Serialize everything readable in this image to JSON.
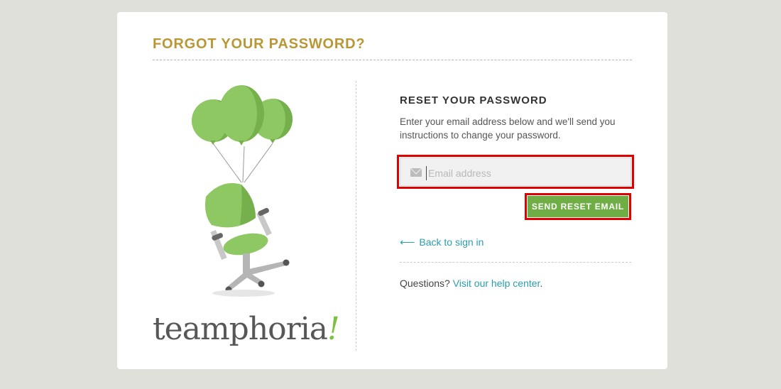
{
  "page": {
    "title": "FORGOT YOUR PASSWORD?",
    "brand_colors": {
      "title": "#b89736",
      "accent": "#6fad45",
      "link": "#2a9dae"
    }
  },
  "brand": {
    "logo_text": "teamphoria",
    "logo_mark": "!"
  },
  "illustration": {
    "icon": "chair-with-balloons-illustration"
  },
  "reset": {
    "section_title": "RESET YOUR PASSWORD",
    "instructions": "Enter your email address below and we'll send you instructions to change your password.",
    "email_placeholder": "Email address",
    "email_value": "",
    "email_icon": "envelope-icon",
    "send_label": "SEND RESET EMAIL",
    "back_icon": "arrow-left-icon",
    "back_label": "Back to sign in"
  },
  "help": {
    "question": "Questions?",
    "link_text": "Visit our help center",
    "trailing": "."
  }
}
